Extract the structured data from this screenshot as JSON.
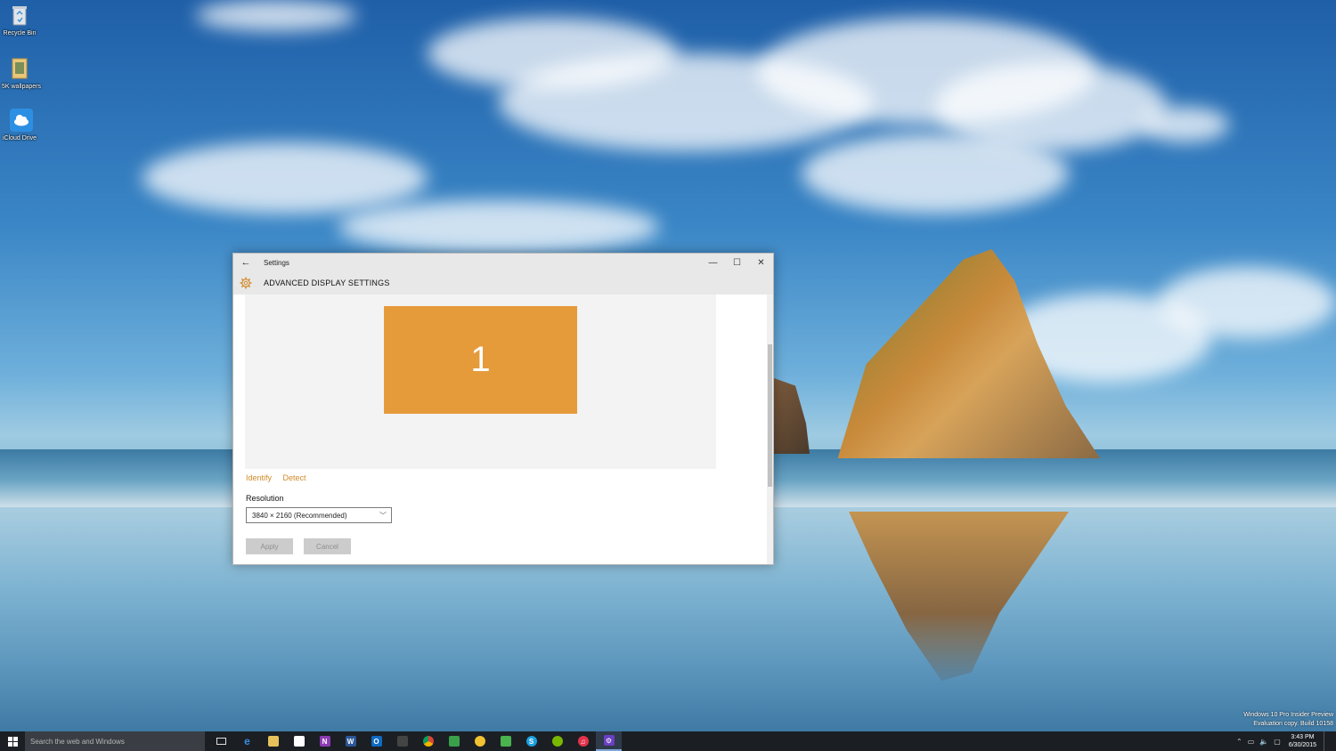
{
  "desktop": {
    "icons": [
      {
        "label": "Recycle Bin",
        "icon": "recycle-bin-icon"
      },
      {
        "label": "5K wallpapers",
        "icon": "folder-icon"
      },
      {
        "label": "iCloud Drive",
        "icon": "cloud-icon"
      }
    ],
    "watermark": {
      "line1": "Windows 10 Pro Insider Preview",
      "line2": "Evaluation copy. Build 10158"
    }
  },
  "window": {
    "title": "Settings",
    "page_title": "ADVANCED DISPLAY SETTINGS",
    "monitor_number": "1",
    "monitor_color": "#e69b3b",
    "links": {
      "identify": "Identify",
      "detect": "Detect"
    },
    "link_color": "#d18a2a",
    "resolution": {
      "label": "Resolution",
      "value": "3840 × 2160 (Recommended)"
    },
    "buttons": {
      "apply": "Apply",
      "cancel": "Cancel"
    }
  },
  "taskbar": {
    "search_placeholder": "Search the web and Windows",
    "apps": [
      {
        "name": "task-view",
        "icon": "task-view-icon"
      },
      {
        "name": "edge",
        "icon": "edge-icon"
      },
      {
        "name": "file-explorer",
        "icon": "folder-icon"
      },
      {
        "name": "store",
        "icon": "store-icon"
      },
      {
        "name": "onenote",
        "icon": "onenote-icon"
      },
      {
        "name": "word",
        "icon": "word-icon"
      },
      {
        "name": "outlook",
        "icon": "outlook-icon"
      },
      {
        "name": "app-dark",
        "icon": "app-icon"
      },
      {
        "name": "chrome",
        "icon": "chrome-icon"
      },
      {
        "name": "app-green",
        "icon": "app-icon"
      },
      {
        "name": "app-yellow",
        "icon": "app-icon"
      },
      {
        "name": "app-green2",
        "icon": "app-icon"
      },
      {
        "name": "skype",
        "icon": "skype-icon"
      },
      {
        "name": "spotify",
        "icon": "spotify-icon"
      },
      {
        "name": "itunes",
        "icon": "itunes-icon"
      },
      {
        "name": "settings",
        "icon": "settings-icon"
      }
    ],
    "clock": {
      "time": "3:43 PM",
      "date": "6/30/2015"
    }
  }
}
